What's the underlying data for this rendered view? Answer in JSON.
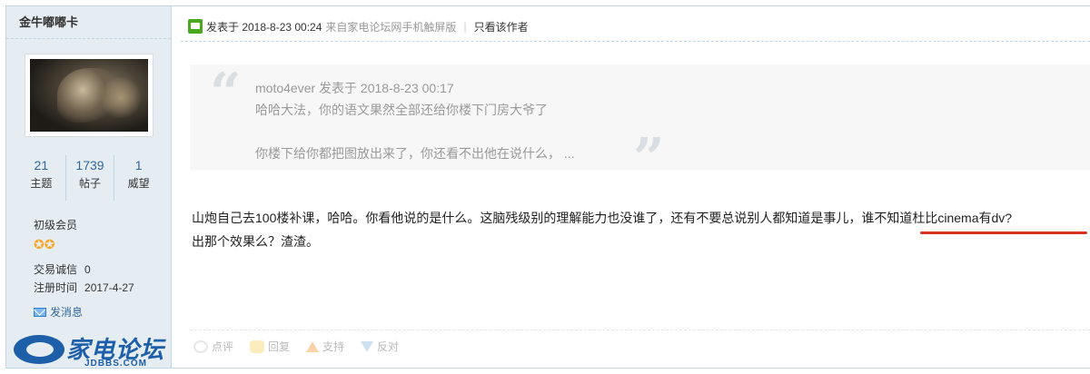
{
  "sidebar": {
    "username": "金牛嘟嘟卡",
    "stats": [
      {
        "value": "21",
        "label": "主题"
      },
      {
        "value": "1739",
        "label": "帖子"
      },
      {
        "value": "1",
        "label": "威望"
      }
    ],
    "rank": "初级会员",
    "stars": "✪✪",
    "trust_label": "交易诚信",
    "trust_value": "0",
    "reg_label": "注册时间",
    "reg_value": "2017-4-27",
    "message_link": "发消息"
  },
  "logo": {
    "text": "家电论坛",
    "sub": "JDBBS.COM"
  },
  "post": {
    "posted_at": "发表于 2018-8-23 00:24",
    "source": "来自家电论坛网手机触屏版",
    "only_author": "只看该作者",
    "quote": {
      "author_line": "moto4ever 发表于 2018-8-23 00:17",
      "line1": "哈哈大法，你的语文果然全部还给你楼下门房大爷了",
      "line2": "你楼下给你都把图放出来了，你还看不出他在说什么， ..."
    },
    "body_line1": "山炮自己去100楼补课，哈哈。你看他说的是什么。这脑残级别的理解能力也没谁了，还有不要总说别人都知道是事儿，谁不知道杜比cinema有dv?",
    "body_line2": "出那个效果么？渣渣。"
  },
  "actions": {
    "comment": "点评",
    "reply": "回复",
    "support": "支持",
    "oppose": "反对"
  }
}
